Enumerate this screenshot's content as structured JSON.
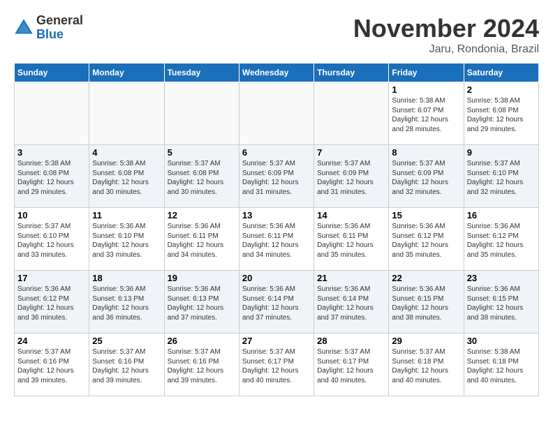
{
  "logo": {
    "general": "General",
    "blue": "Blue"
  },
  "header": {
    "month": "November 2024",
    "location": "Jaru, Rondonia, Brazil"
  },
  "weekdays": [
    "Sunday",
    "Monday",
    "Tuesday",
    "Wednesday",
    "Thursday",
    "Friday",
    "Saturday"
  ],
  "weeks": [
    [
      {
        "day": "",
        "info": ""
      },
      {
        "day": "",
        "info": ""
      },
      {
        "day": "",
        "info": ""
      },
      {
        "day": "",
        "info": ""
      },
      {
        "day": "",
        "info": ""
      },
      {
        "day": "1",
        "info": "Sunrise: 5:38 AM\nSunset: 6:07 PM\nDaylight: 12 hours and 28 minutes."
      },
      {
        "day": "2",
        "info": "Sunrise: 5:38 AM\nSunset: 6:08 PM\nDaylight: 12 hours and 29 minutes."
      }
    ],
    [
      {
        "day": "3",
        "info": "Sunrise: 5:38 AM\nSunset: 6:08 PM\nDaylight: 12 hours and 29 minutes."
      },
      {
        "day": "4",
        "info": "Sunrise: 5:38 AM\nSunset: 6:08 PM\nDaylight: 12 hours and 30 minutes."
      },
      {
        "day": "5",
        "info": "Sunrise: 5:37 AM\nSunset: 6:08 PM\nDaylight: 12 hours and 30 minutes."
      },
      {
        "day": "6",
        "info": "Sunrise: 5:37 AM\nSunset: 6:09 PM\nDaylight: 12 hours and 31 minutes."
      },
      {
        "day": "7",
        "info": "Sunrise: 5:37 AM\nSunset: 6:09 PM\nDaylight: 12 hours and 31 minutes."
      },
      {
        "day": "8",
        "info": "Sunrise: 5:37 AM\nSunset: 6:09 PM\nDaylight: 12 hours and 32 minutes."
      },
      {
        "day": "9",
        "info": "Sunrise: 5:37 AM\nSunset: 6:10 PM\nDaylight: 12 hours and 32 minutes."
      }
    ],
    [
      {
        "day": "10",
        "info": "Sunrise: 5:37 AM\nSunset: 6:10 PM\nDaylight: 12 hours and 33 minutes."
      },
      {
        "day": "11",
        "info": "Sunrise: 5:36 AM\nSunset: 6:10 PM\nDaylight: 12 hours and 33 minutes."
      },
      {
        "day": "12",
        "info": "Sunrise: 5:36 AM\nSunset: 6:11 PM\nDaylight: 12 hours and 34 minutes."
      },
      {
        "day": "13",
        "info": "Sunrise: 5:36 AM\nSunset: 6:11 PM\nDaylight: 12 hours and 34 minutes."
      },
      {
        "day": "14",
        "info": "Sunrise: 5:36 AM\nSunset: 6:11 PM\nDaylight: 12 hours and 35 minutes."
      },
      {
        "day": "15",
        "info": "Sunrise: 5:36 AM\nSunset: 6:12 PM\nDaylight: 12 hours and 35 minutes."
      },
      {
        "day": "16",
        "info": "Sunrise: 5:36 AM\nSunset: 6:12 PM\nDaylight: 12 hours and 35 minutes."
      }
    ],
    [
      {
        "day": "17",
        "info": "Sunrise: 5:36 AM\nSunset: 6:12 PM\nDaylight: 12 hours and 36 minutes."
      },
      {
        "day": "18",
        "info": "Sunrise: 5:36 AM\nSunset: 6:13 PM\nDaylight: 12 hours and 36 minutes."
      },
      {
        "day": "19",
        "info": "Sunrise: 5:36 AM\nSunset: 6:13 PM\nDaylight: 12 hours and 37 minutes."
      },
      {
        "day": "20",
        "info": "Sunrise: 5:36 AM\nSunset: 6:14 PM\nDaylight: 12 hours and 37 minutes."
      },
      {
        "day": "21",
        "info": "Sunrise: 5:36 AM\nSunset: 6:14 PM\nDaylight: 12 hours and 37 minutes."
      },
      {
        "day": "22",
        "info": "Sunrise: 5:36 AM\nSunset: 6:15 PM\nDaylight: 12 hours and 38 minutes."
      },
      {
        "day": "23",
        "info": "Sunrise: 5:36 AM\nSunset: 6:15 PM\nDaylight: 12 hours and 38 minutes."
      }
    ],
    [
      {
        "day": "24",
        "info": "Sunrise: 5:37 AM\nSunset: 6:16 PM\nDaylight: 12 hours and 39 minutes."
      },
      {
        "day": "25",
        "info": "Sunrise: 5:37 AM\nSunset: 6:16 PM\nDaylight: 12 hours and 39 minutes."
      },
      {
        "day": "26",
        "info": "Sunrise: 5:37 AM\nSunset: 6:16 PM\nDaylight: 12 hours and 39 minutes."
      },
      {
        "day": "27",
        "info": "Sunrise: 5:37 AM\nSunset: 6:17 PM\nDaylight: 12 hours and 40 minutes."
      },
      {
        "day": "28",
        "info": "Sunrise: 5:37 AM\nSunset: 6:17 PM\nDaylight: 12 hours and 40 minutes."
      },
      {
        "day": "29",
        "info": "Sunrise: 5:37 AM\nSunset: 6:18 PM\nDaylight: 12 hours and 40 minutes."
      },
      {
        "day": "30",
        "info": "Sunrise: 5:38 AM\nSunset: 6:18 PM\nDaylight: 12 hours and 40 minutes."
      }
    ]
  ]
}
